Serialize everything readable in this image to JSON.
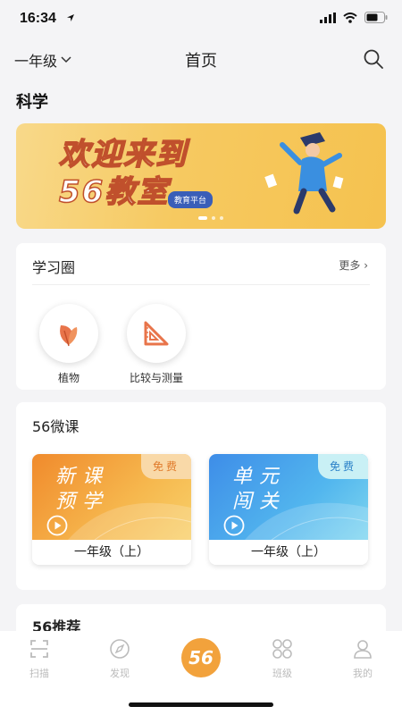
{
  "status": {
    "time": "16:34"
  },
  "header": {
    "grade": "一年级",
    "title": "首页"
  },
  "subject": "科学",
  "banner": {
    "line1": "欢迎来到",
    "line2": "56教室",
    "badge": "教育平台"
  },
  "circle_section": {
    "title": "学习圈",
    "more": "更多 ›",
    "items": [
      {
        "label": "植物",
        "icon": "leaf-icon"
      },
      {
        "label": "比较与测量",
        "icon": "triangle-ruler-icon"
      }
    ]
  },
  "micro_section": {
    "title": "56微课",
    "courses": [
      {
        "line1": "新课",
        "line2": "预学",
        "tag": "免费",
        "grade": "一年级（上）",
        "color": "#f5a042"
      },
      {
        "line1": "单元",
        "line2": "闯关",
        "tag": "免费",
        "grade": "一年级（上）",
        "color": "#4da8ee"
      }
    ]
  },
  "recommend_section": {
    "title": "56推荐"
  },
  "tabbar": {
    "items": [
      {
        "label": "扫描",
        "icon": "scan-icon"
      },
      {
        "label": "发现",
        "icon": "compass-icon"
      },
      {
        "label": "56",
        "icon": "home-logo-icon"
      },
      {
        "label": "班级",
        "icon": "class-icon"
      },
      {
        "label": "我的",
        "icon": "profile-icon"
      }
    ]
  },
  "colors": {
    "accent": "#f2a23c",
    "background": "#f4f4f6"
  }
}
